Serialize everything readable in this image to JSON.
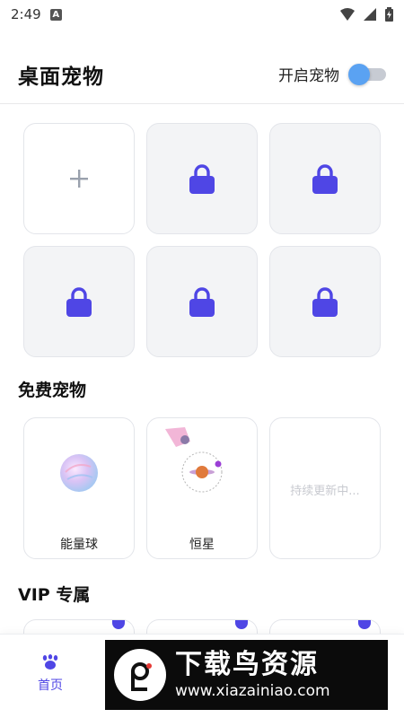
{
  "status_bar": {
    "time": "2:49",
    "notification_letter": "A"
  },
  "header": {
    "title": "桌面宠物",
    "toggle_label": "开启宠物",
    "toggle_on": true
  },
  "slots": {
    "items": [
      {
        "type": "add",
        "icon": "plus-icon"
      },
      {
        "type": "locked",
        "icon": "lock-icon"
      },
      {
        "type": "locked",
        "icon": "lock-icon"
      },
      {
        "type": "locked",
        "icon": "lock-icon"
      },
      {
        "type": "locked",
        "icon": "lock-icon"
      },
      {
        "type": "locked",
        "icon": "lock-icon"
      }
    ]
  },
  "free_section": {
    "title": "免费宠物",
    "pets": [
      {
        "name": "能量球",
        "icon": "energy-ball-icon"
      },
      {
        "name": "恒星",
        "icon": "star-planet-icon"
      },
      {
        "name": "",
        "placeholder": "持续更新中..."
      }
    ]
  },
  "vip_section": {
    "title": "VIP 专属"
  },
  "bottom_nav": {
    "home_label": "首页",
    "home_icon": "paw-icon"
  },
  "watermark": {
    "title": "下载鸟资源",
    "url": "www.xiazainiao.com"
  },
  "colors": {
    "accent": "#4f46e5",
    "toggle_thumb": "#5aa2f2",
    "card_bg": "#f3f4f6"
  }
}
